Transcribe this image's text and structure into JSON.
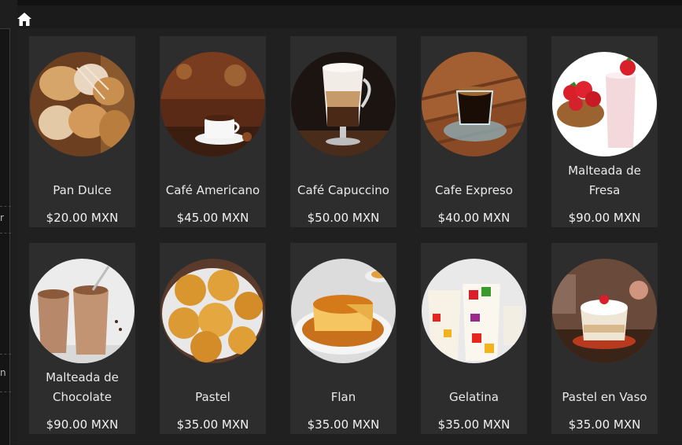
{
  "left_panel": {
    "glyphs": [
      "r",
      "n"
    ]
  },
  "products": [
    {
      "name": "Pan Dulce",
      "price": "$20.00 MXN",
      "image": "pan-dulce-image"
    },
    {
      "name": "Café Americano",
      "price": "$45.00 MXN",
      "image": "cafe-americano-image"
    },
    {
      "name": "Café Capuccino",
      "price": "$50.00 MXN",
      "image": "cafe-capuccino-image"
    },
    {
      "name": "Cafe Expreso",
      "price": "$40.00 MXN",
      "image": "cafe-expreso-image"
    },
    {
      "name": "Malteada de Fresa",
      "price": "$90.00 MXN",
      "image": "malteada-fresa-image"
    },
    {
      "name": "Malteada de Chocolate",
      "price": "$90.00 MXN",
      "image": "malteada-chocolate-image"
    },
    {
      "name": "Pastel",
      "price": "$35.00 MXN",
      "image": "pastel-image"
    },
    {
      "name": "Flan",
      "price": "$35.00 MXN",
      "image": "flan-image"
    },
    {
      "name": "Gelatina",
      "price": "$35.00 MXN",
      "image": "gelatina-image"
    },
    {
      "name": "Pastel en Vaso",
      "price": "$35.00 MXN",
      "image": "pastel-en-vaso-image"
    }
  ]
}
